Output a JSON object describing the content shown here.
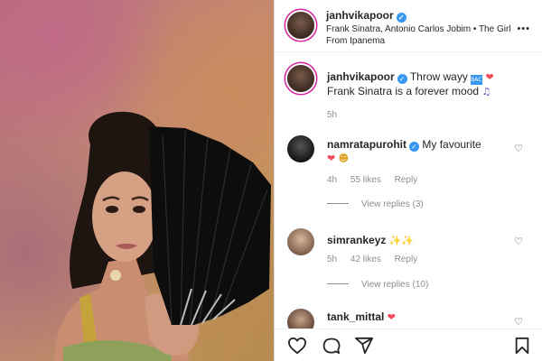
{
  "post": {
    "author": "janhvikapoor",
    "audio": "Frank Sinatra, Antonio Carlos Jobim • The Girl From Ipanema"
  },
  "caption": {
    "user": "janhvikapoor",
    "line1": "Throw wayy",
    "line2": "Frank Sinatra is a forever mood",
    "time": "5h"
  },
  "comments": [
    {
      "user": "namratapurohit",
      "text": "My favourite",
      "time": "4h",
      "likes": "55 likes",
      "reply": "Reply",
      "view_replies": "View replies (3)"
    },
    {
      "user": "simrankeyz",
      "text": "",
      "time": "5h",
      "likes": "42 likes",
      "reply": "Reply",
      "view_replies": "View replies (10)"
    },
    {
      "user": "tank_mittal",
      "text": ""
    }
  ],
  "icons": {
    "verified": "verified-badge-icon",
    "more": "more-options-icon",
    "heart": "heart-icon",
    "comment": "comment-icon",
    "share": "share-icon",
    "save": "bookmark-icon"
  },
  "colors": {
    "verified": "#3897f0",
    "heart_red": "#ed4956",
    "muted_text": "#8e8e8e",
    "story_ring": "#d6249f"
  }
}
